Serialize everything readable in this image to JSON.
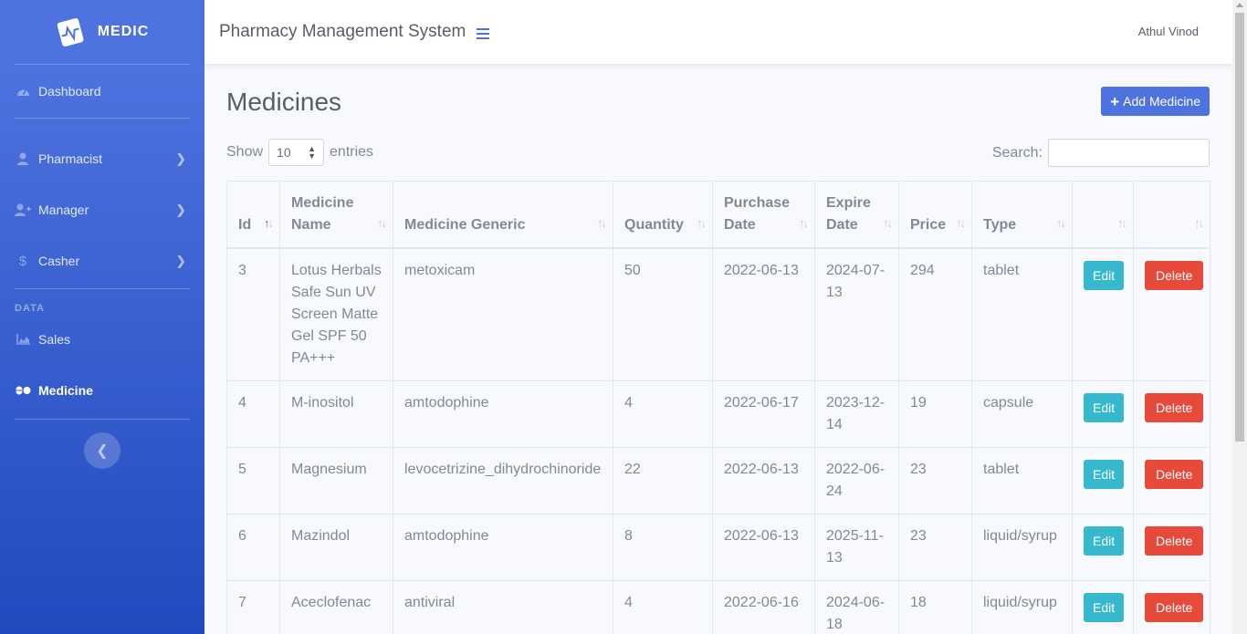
{
  "brand": {
    "name": "MEDIC"
  },
  "sidebar": {
    "items": [
      {
        "label": "Dashboard",
        "icon": "tachometer-icon"
      },
      {
        "label": "Pharmacist",
        "icon": "user-icon"
      },
      {
        "label": "Manager",
        "icon": "user-plus-icon"
      },
      {
        "label": "Casher",
        "icon": "dollar-icon"
      }
    ],
    "heading": "DATA",
    "data_items": [
      {
        "label": "Sales",
        "icon": "area-chart-icon"
      },
      {
        "label": "Medicine",
        "icon": "pills-icon"
      }
    ]
  },
  "topbar": {
    "title": "Pharmacy Management System",
    "user": "Athul Vinod"
  },
  "main": {
    "title": "Medicines",
    "add_button": "Add Medicine",
    "show_label": "Show",
    "entries_label": "entries",
    "page_length": "10",
    "search_label": "Search:",
    "search_value": ""
  },
  "table": {
    "headers": [
      "Id",
      "Medicine Name",
      "Medicine Generic",
      "Quantity",
      "Purchase Date",
      "Expire Date",
      "Price",
      "Type",
      "",
      ""
    ],
    "edit_label": "Edit",
    "delete_label": "Delete",
    "rows": [
      [
        "3",
        "Lotus Herbals Safe Sun UV Screen Matte Gel SPF 50 PA+++",
        "metoxicam",
        "50",
        "2022-06-13",
        "2024-07-13",
        "294",
        "tablet"
      ],
      [
        "4",
        "M-inositol",
        "amtodophine",
        "4",
        "2022-06-17",
        "2023-12-14",
        "19",
        "capsule"
      ],
      [
        "5",
        "Magnesium",
        "levocetrizine_dihydrochinoride",
        "22",
        "2022-06-13",
        "2022-06-24",
        "23",
        "tablet"
      ],
      [
        "6",
        "Mazindol",
        "amtodophine",
        "8",
        "2022-06-13",
        "2025-11-13",
        "23",
        "liquid/syrup"
      ],
      [
        "7",
        "Aceclofenac",
        "antiviral",
        "4",
        "2022-06-16",
        "2024-06-18",
        "18",
        "liquid/syrup"
      ]
    ]
  },
  "colors": {
    "primary": "#4e73df",
    "info": "#36b9cc",
    "danger": "#e74a3b"
  }
}
